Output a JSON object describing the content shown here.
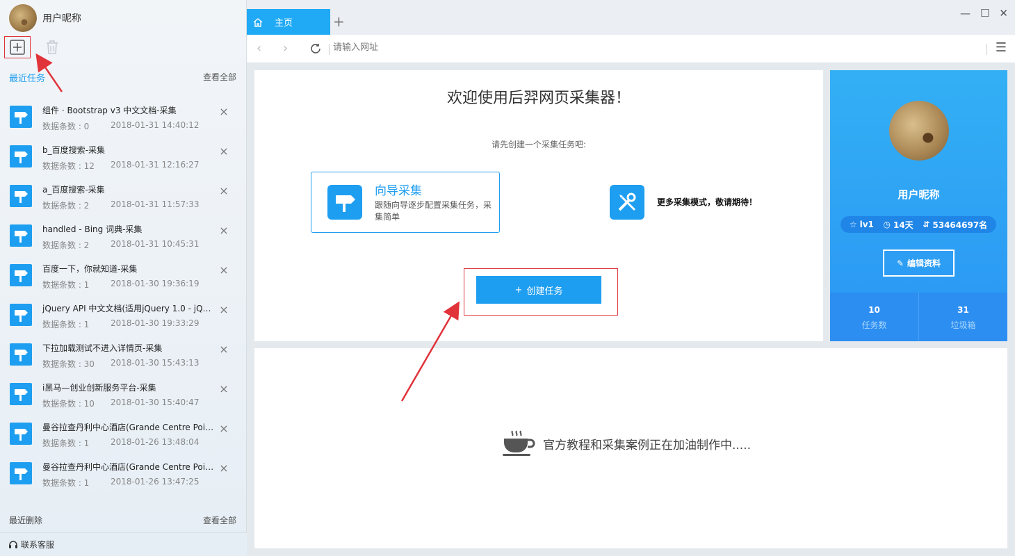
{
  "user": {
    "nickname": "用户昵称"
  },
  "sidebar": {
    "recent_title": "最近任务",
    "view_all": "查看全部",
    "tasks": [
      {
        "title": "组件 · Bootstrap v3 中文文档-采集",
        "meta": "数据条数 : 0",
        "time": "2018-01-31 14:40:12"
      },
      {
        "title": "b_百度搜索-采集",
        "meta": "数据条数 : 12",
        "time": "2018-01-31 12:16:27"
      },
      {
        "title": "a_百度搜索-采集",
        "meta": "数据条数 : 2",
        "time": "2018-01-31 11:57:33"
      },
      {
        "title": "handled - Bing 词典-采集",
        "meta": "数据条数 : 2",
        "time": "2018-01-31 10:45:31"
      },
      {
        "title": "百度一下，你就知道-采集",
        "meta": "数据条数 : 1",
        "time": "2018-01-30 19:36:19"
      },
      {
        "title": "jQuery API 中文文档(适用jQuery 1.0 - jQuery...",
        "meta": "数据条数 : 1",
        "time": "2018-01-30 19:33:29"
      },
      {
        "title": "下拉加载测试不进入详情页-采集",
        "meta": "数据条数 : 30",
        "time": "2018-01-30 15:43:13"
      },
      {
        "title": "i黑马—创业创新服务平台-采集",
        "meta": "数据条数 : 10",
        "time": "2018-01-30 15:40:47"
      },
      {
        "title": "曼谷拉查丹利中心酒店(Grande Centre Point...",
        "meta": "数据条数 : 1",
        "time": "2018-01-26 13:48:04"
      },
      {
        "title": "曼谷拉查丹利中心酒店(Grande Centre Point...",
        "meta": "数据条数 : 1",
        "time": "2018-01-26 13:47:25"
      }
    ],
    "deleted_title": "最近删除",
    "deleted_view_all": "查看全部",
    "support": "联系客服"
  },
  "tabs": {
    "home_label": "主页",
    "add": "+"
  },
  "address": {
    "placeholder": "请输入网址"
  },
  "welcome": {
    "title": "欢迎使用后羿网页采集器！",
    "subtitle": "请先创建一个采集任务吧:",
    "wizard_title": "向导采集",
    "wizard_desc": "跟随向导逐步配置采集任务，采集简单",
    "more_modes": "更多采集模式，敬请期待！",
    "create_button": "创建任务"
  },
  "profile": {
    "nickname": "用户昵称",
    "level": "lv1",
    "days": "14天",
    "rank": "53464697名",
    "edit_button": "编辑资料",
    "task_count": "10",
    "task_label": "任务数",
    "trash_count": "31",
    "trash_label": "垃圾箱"
  },
  "tutorial": {
    "text": "官方教程和采集案例正在加油制作中....."
  },
  "colors": {
    "accent": "#1e9ef0",
    "annotation": "#e0333a"
  }
}
